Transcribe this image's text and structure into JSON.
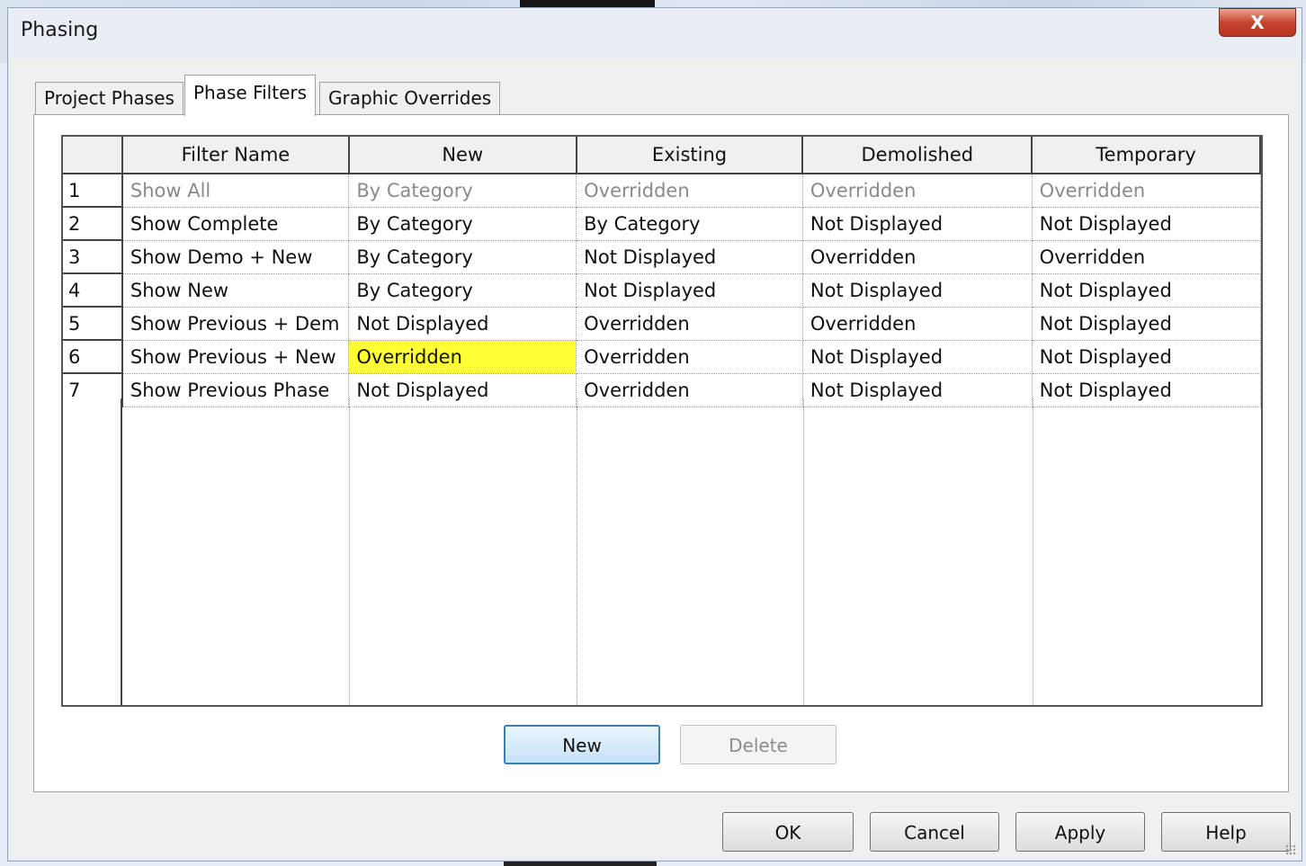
{
  "window": {
    "title": "Phasing",
    "close_label": "X"
  },
  "tabs": [
    {
      "label": "Project Phases",
      "active": false
    },
    {
      "label": "Phase Filters",
      "active": true
    },
    {
      "label": "Graphic Overrides",
      "active": false
    }
  ],
  "table": {
    "columns": [
      "Filter Name",
      "New",
      "Existing",
      "Demolished",
      "Temporary"
    ],
    "rows": [
      {
        "num": "1",
        "cells": [
          "Show All",
          "By Category",
          "Overridden",
          "Overridden",
          "Overridden"
        ],
        "muted": true
      },
      {
        "num": "2",
        "cells": [
          "Show Complete",
          "By Category",
          "By Category",
          "Not Displayed",
          "Not Displayed"
        ]
      },
      {
        "num": "3",
        "cells": [
          "Show Demo + New",
          "By Category",
          "Not Displayed",
          "Overridden",
          "Overridden"
        ]
      },
      {
        "num": "4",
        "cells": [
          "Show New",
          "By Category",
          "Not Displayed",
          "Not Displayed",
          "Not Displayed"
        ]
      },
      {
        "num": "5",
        "cells": [
          "Show Previous + Dem",
          "Not Displayed",
          "Overridden",
          "Overridden",
          "Not Displayed"
        ]
      },
      {
        "num": "6",
        "cells": [
          "Show Previous + New",
          "Overridden",
          "Overridden",
          "Not Displayed",
          "Not Displayed"
        ],
        "highlight_col": 1
      },
      {
        "num": "7",
        "cells": [
          "Show Previous Phase",
          "Not Displayed",
          "Overridden",
          "Not Displayed",
          "Not Displayed"
        ]
      }
    ],
    "highlight_color": "#ffff33"
  },
  "panel_buttons": {
    "new": "New",
    "delete": "Delete"
  },
  "dialog_buttons": {
    "ok": "OK",
    "cancel": "Cancel",
    "apply": "Apply",
    "help": "Help"
  },
  "colors": {
    "close_button": "#c7452e",
    "focus_border": "#3c7fb1"
  }
}
